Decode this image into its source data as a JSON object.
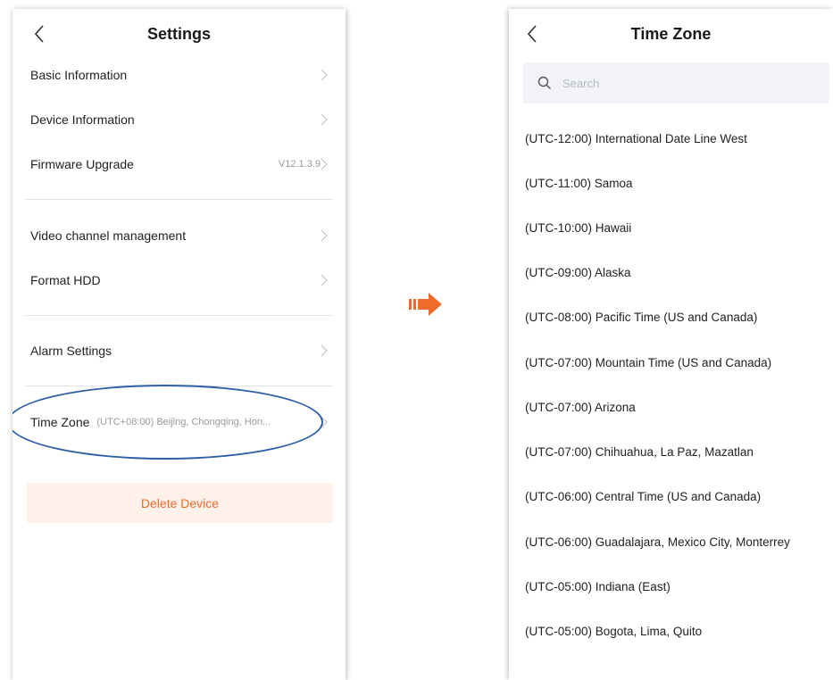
{
  "settings": {
    "title": "Settings",
    "rows": [
      {
        "label": "Basic Information",
        "value": ""
      },
      {
        "label": "Device Information",
        "value": ""
      },
      {
        "label": "Firmware Upgrade",
        "value": "V12.1.3.9"
      },
      {
        "label": "Video channel management",
        "value": ""
      },
      {
        "label": "Format HDD",
        "value": ""
      },
      {
        "label": "Alarm Settings",
        "value": ""
      }
    ],
    "time_zone": {
      "label": "Time Zone",
      "value": "(UTC+08:00) Beijing, Chongqing, Hon..."
    },
    "delete_label": "Delete Device"
  },
  "timezone_page": {
    "title": "Time Zone",
    "search_placeholder": "Search",
    "items": [
      "(UTC-12:00) International Date Line West",
      "(UTC-11:00) Samoa",
      "(UTC-10:00) Hawaii",
      "(UTC-09:00) Alaska",
      "(UTC-08:00) Pacific Time (US and Canada)",
      "(UTC-07:00) Mountain Time (US and Canada)",
      "(UTC-07:00) Arizona",
      "(UTC-07:00) Chihuahua, La Paz, Mazatlan",
      "(UTC-06:00) Central Time (US and Canada)",
      "(UTC-06:00) Guadalajara, Mexico City, Monterrey",
      "(UTC-05:00) Indiana (East)",
      "(UTC-05:00) Bogota, Lima, Quito"
    ]
  },
  "colors": {
    "accent": "#f06a2c",
    "highlight_ring": "#2f5ea8",
    "delete_bg": "#fdf1ea",
    "search_bg": "#f1f3f9"
  }
}
